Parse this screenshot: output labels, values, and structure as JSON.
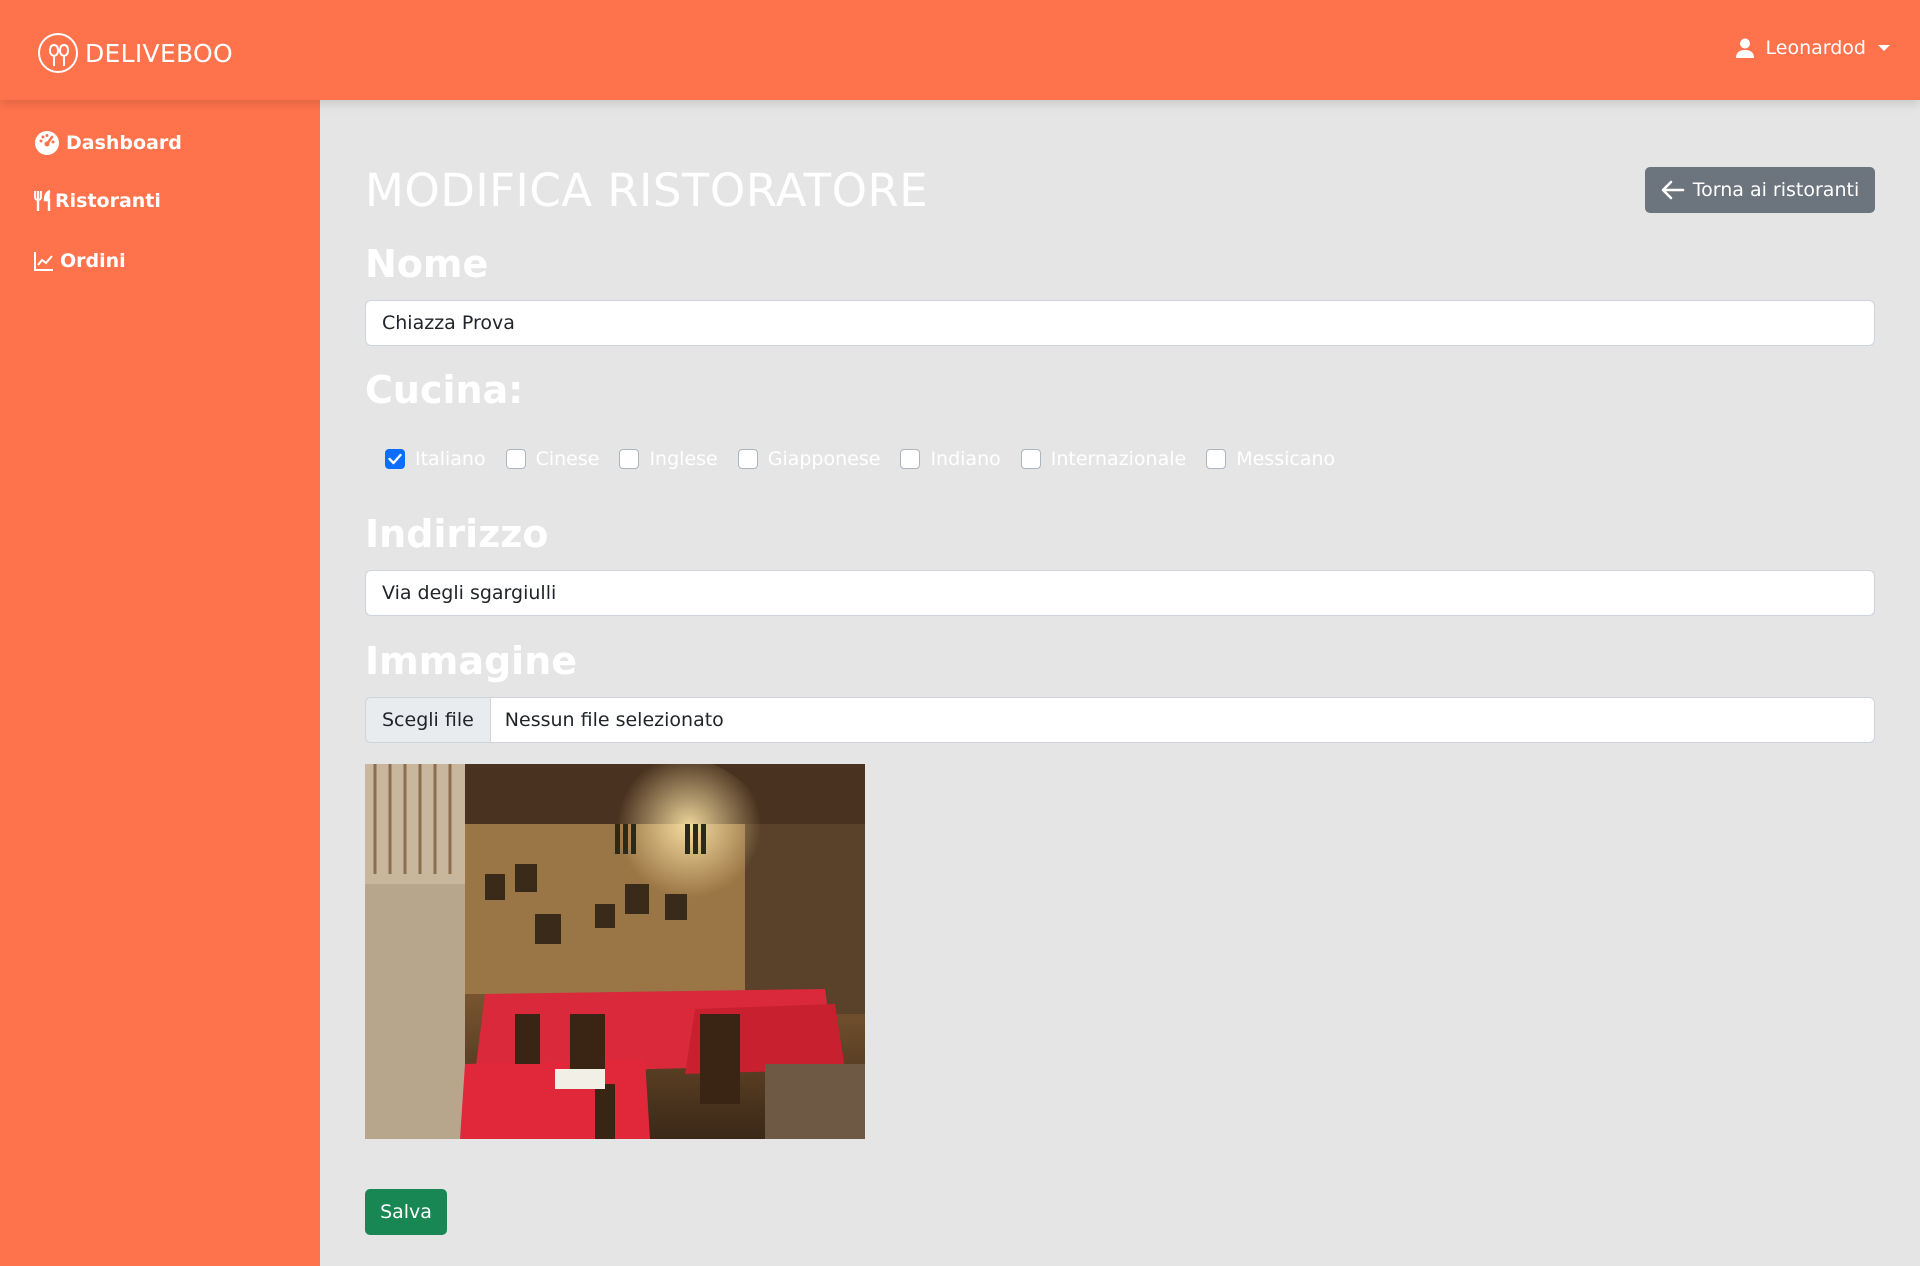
{
  "app": {
    "brand": "DELIVEBOO"
  },
  "user": {
    "name": "Leonardod"
  },
  "sidebar": {
    "items": [
      {
        "label": "Dashboard",
        "icon": "gauge-icon"
      },
      {
        "label": "Ristoranti",
        "icon": "utensils-icon"
      },
      {
        "label": "Ordini",
        "icon": "chart-line-icon"
      }
    ]
  },
  "page": {
    "title": "MODIFICA RISTORATORE",
    "back_label": "Torna ai ristoranti"
  },
  "form": {
    "name_label": "Nome",
    "name_value": "Chiazza Prova",
    "cuisine_label": "Cucina:",
    "cuisines": [
      {
        "label": "Italiano",
        "checked": true
      },
      {
        "label": "Cinese",
        "checked": false
      },
      {
        "label": "Inglese",
        "checked": false
      },
      {
        "label": "Giapponese",
        "checked": false
      },
      {
        "label": "Indiano",
        "checked": false
      },
      {
        "label": "Internazionale",
        "checked": false
      },
      {
        "label": "Messicano",
        "checked": false
      }
    ],
    "address_label": "Indirizzo",
    "address_value": "Via degli sgargiulli",
    "image_label": "Immagine",
    "file_button": "Scegli file",
    "file_status": "Nessun file selezionato",
    "save_label": "Salva"
  },
  "colors": {
    "brand": "#ff734c",
    "background": "#e5e5e5",
    "secondary_button": "#6c757d",
    "success_button": "#198754",
    "checkbox_checked": "#0d6efd"
  }
}
